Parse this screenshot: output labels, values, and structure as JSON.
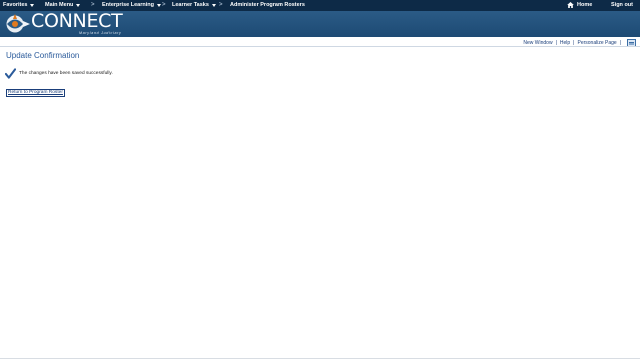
{
  "topnav": {
    "favorites": "Favorites",
    "main_menu": "Main Menu",
    "enterprise_learning": "Enterprise Learning",
    "learner_tasks": "Learner Tasks",
    "current_page": "Administer Program Rosters",
    "home": "Home",
    "sign_out": "Sign out",
    "separator": ">"
  },
  "branding": {
    "name": "CONNECT",
    "subtitle": "Maryland Judiciary",
    "bar_color": "#0d2a47",
    "banner_color": "#1d4a74"
  },
  "utility": {
    "new_window": "New Window",
    "help": "Help",
    "personalize_page": "Personalize Page",
    "separator": "|"
  },
  "page": {
    "title": "Update Confirmation",
    "message": "The changes have been saved successfully.",
    "return_link": "Return to Program Roster"
  }
}
